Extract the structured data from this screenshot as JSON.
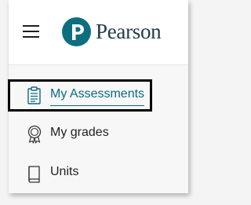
{
  "header": {
    "menu_icon": "hamburger-menu-icon",
    "logo_icon": "pearson-p-logo-icon",
    "brand_name": "Pearson",
    "brand_color": "#0d6e80"
  },
  "nav": {
    "items": [
      {
        "label": "My Assessments",
        "icon": "clipboard-icon",
        "active": true
      },
      {
        "label": "My grades",
        "icon": "award-ribbon-icon",
        "active": false
      },
      {
        "label": "Units",
        "icon": "book-icon",
        "active": false
      }
    ],
    "active_color": "#0b6b82"
  }
}
